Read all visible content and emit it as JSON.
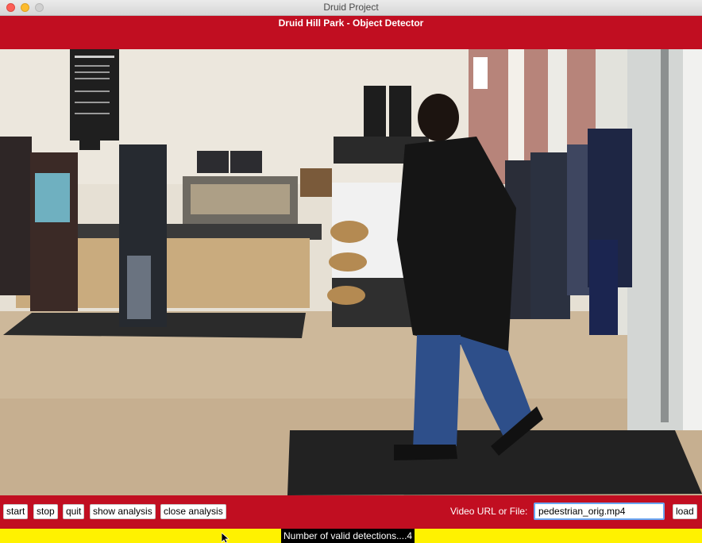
{
  "window": {
    "title": "Druid Project"
  },
  "app": {
    "title": "Druid Hill Park - Object Detector"
  },
  "video": {
    "description_icon": "video-frame"
  },
  "controls": {
    "start_label": "start",
    "stop_label": "stop",
    "quit_label": "quit",
    "show_analysis_label": "show analysis",
    "close_analysis_label": "close analysis",
    "url_label": "Video URL or File:",
    "url_value": "pedestrian_orig.mp4",
    "load_label": "load"
  },
  "status": {
    "text": "Number of valid detections....4"
  },
  "colors": {
    "header_red": "#c10e21",
    "status_yellow": "#fff200",
    "input_focus": "#6aa6f2"
  }
}
